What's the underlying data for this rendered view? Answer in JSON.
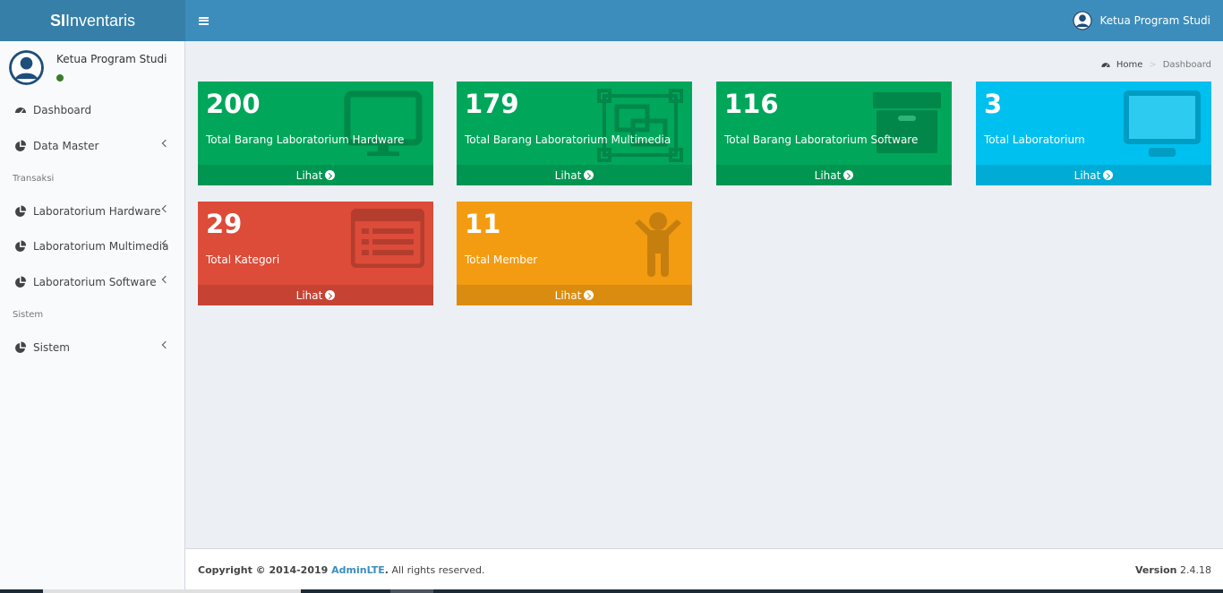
{
  "app": {
    "logo_bold": "SI",
    "logo_rest": "Inventaris"
  },
  "header": {
    "user_name": "Ketua Program Studi"
  },
  "sidebar": {
    "user_name": "Ketua Program Studi",
    "status_color": "#3a7d2c",
    "items": [
      {
        "label": "Dashboard",
        "icon": "dashboard-icon"
      },
      {
        "label": "Data Master",
        "icon": "pie-chart-icon"
      },
      {
        "label": "Laboratorium Hardware",
        "icon": "pie-chart-icon"
      },
      {
        "label": "Laboratorium Multimedia",
        "icon": "pie-chart-icon"
      },
      {
        "label": "Laboratorium Software",
        "icon": "pie-chart-icon"
      },
      {
        "label": "Sistem",
        "icon": "pie-chart-icon"
      }
    ],
    "headers": [
      "Transaksi",
      "Sistem"
    ]
  },
  "breadcrumb": {
    "home": "Home",
    "current": "Dashboard"
  },
  "boxes": [
    {
      "value": "200",
      "label": "Total Barang Laboratorium Hardware",
      "link": "Lihat",
      "color": "#00a65a",
      "icon": "desktop-icon"
    },
    {
      "value": "179",
      "label": "Total Barang Laboratorium Multimedia",
      "link": "Lihat",
      "color": "#00a65a",
      "icon": "object-group-icon"
    },
    {
      "value": "116",
      "label": "Total Barang Laboratorium Software",
      "link": "Lihat",
      "color": "#00a65a",
      "icon": "archive-icon"
    },
    {
      "value": "3",
      "label": "Total Laboratorium",
      "link": "Lihat",
      "color": "#00c0ef",
      "icon": "tv-icon"
    },
    {
      "value": "29",
      "label": "Total Kategori",
      "link": "Lihat",
      "color": "#dd4b39",
      "icon": "list-alt-icon"
    },
    {
      "value": "11",
      "label": "Total Member",
      "link": "Lihat",
      "color": "#f39c12",
      "icon": "child-icon"
    }
  ],
  "footer": {
    "copyright_prefix": "Copyright © 2014-2019 ",
    "brand": "AdminLTE",
    "copyright_suffix": ". All rights reserved.",
    "version_label": "Version",
    "version": "2.4.18"
  }
}
